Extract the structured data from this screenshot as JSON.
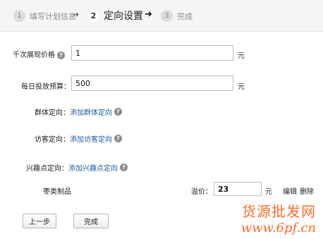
{
  "steps": [
    {
      "num": "1",
      "label": "填写计划信息"
    },
    {
      "num": "2",
      "label": "定向设置"
    },
    {
      "num": "3",
      "label": "完成"
    }
  ],
  "arrow_glyph": "➜",
  "form": {
    "cpm_price": {
      "label": "千次展现价格",
      "value": "1",
      "unit": "元"
    },
    "daily_budget": {
      "label": "每日投放预算：",
      "value": "500",
      "unit": "元"
    },
    "group_targeting": {
      "label": "群体定向：",
      "link": "添加群体定向"
    },
    "visitor_targeting": {
      "label": "访客定向：",
      "link": "添加访客定向"
    },
    "interest_targeting": {
      "label": "兴趣点定向：",
      "link": "添加兴趣点定向"
    }
  },
  "interest_row": {
    "name": "枣类制品",
    "premium_label": "溢价：",
    "premium_value": "23",
    "unit": "元",
    "edit": "编辑",
    "delete": "删除"
  },
  "buttons": {
    "prev": "上一步",
    "finish": "完成"
  },
  "help_glyph": "?",
  "watermark": {
    "line1": "货源批发网",
    "line2": "www.6pf.cn"
  },
  "colors": {
    "link": "#1f5a9c",
    "watermark": "#ff6b2c"
  }
}
